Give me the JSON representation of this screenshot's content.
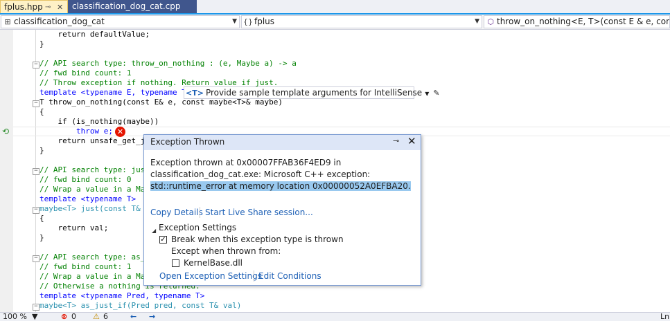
{
  "tabs": {
    "active": {
      "label": "fplus.hpp",
      "pin": "⊸",
      "close": "✕"
    },
    "inactive": {
      "label": "classification_dog_cat.cpp"
    }
  },
  "navbar": {
    "project": "classification_dog_cat",
    "scope": "fplus",
    "member": "throw_on_nothing<E, T>(const E & e, const ma"
  },
  "code_lines": [
    "    return defaultValue;",
    "}",
    "// API search type: throw_on_nothing : (e, Maybe a) -> a",
    "// fwd bind count: 1",
    "// Throw exception if nothing. Return value if just.",
    "template <typename E, typename T>",
    "T throw_on_nothing(const E& e, const maybe<T>& maybe)",
    "{",
    "    if (is_nothing(maybe))",
    "        throw e;",
    "    return unsafe_get_jus",
    "}",
    "// API search type: just",
    "// fwd bind count: 0",
    "// Wrap a value in a Mayb",
    "template <typename T>",
    "maybe<T> just(const T& va",
    "{",
    "    return val;",
    "}",
    "// API search type: as_ju",
    "// fwd bind count: 1",
    "// Wrap a value in a Mayb",
    "// Otherwise a nothing is returned.",
    "template <typename Pred, typename T>",
    "maybe<T> as_just_if(Pred pred, const T& val)"
  ],
  "template_hint": {
    "badge": "<T>",
    "label": "Provide sample template arguments for IntelliSense"
  },
  "exception_popup": {
    "title": "Exception Thrown",
    "message_line1": "Exception thrown at 0x00007FFAB36F4ED9 in",
    "message_line2": "classification_dog_cat.exe: Microsoft C++ exception:",
    "message_line3": "std::runtime_error at memory location 0x00000052A0EFBA20.",
    "copy_details": "Copy Details",
    "live_share": "Start Live Share session...",
    "settings_header": "Exception Settings",
    "break_when": "Break when this exception type is thrown",
    "break_checked": true,
    "except_when": "Except when thrown from:",
    "kernelbase": "KernelBase.dll",
    "kernelbase_checked": false,
    "open_settings": "Open Exception Settings",
    "edit_conditions": "Edit Conditions"
  },
  "statusbar": {
    "zoom": "100 %",
    "errors": "0",
    "warnings": "6",
    "line_label": "Ln:"
  },
  "colors": {
    "accent": "#1c97ea",
    "active_tab": "#fef1c6",
    "inactive_tab": "#40568d",
    "popup_header": "#dde6f7",
    "selection": "#99c9ef",
    "error": "#e51400"
  }
}
